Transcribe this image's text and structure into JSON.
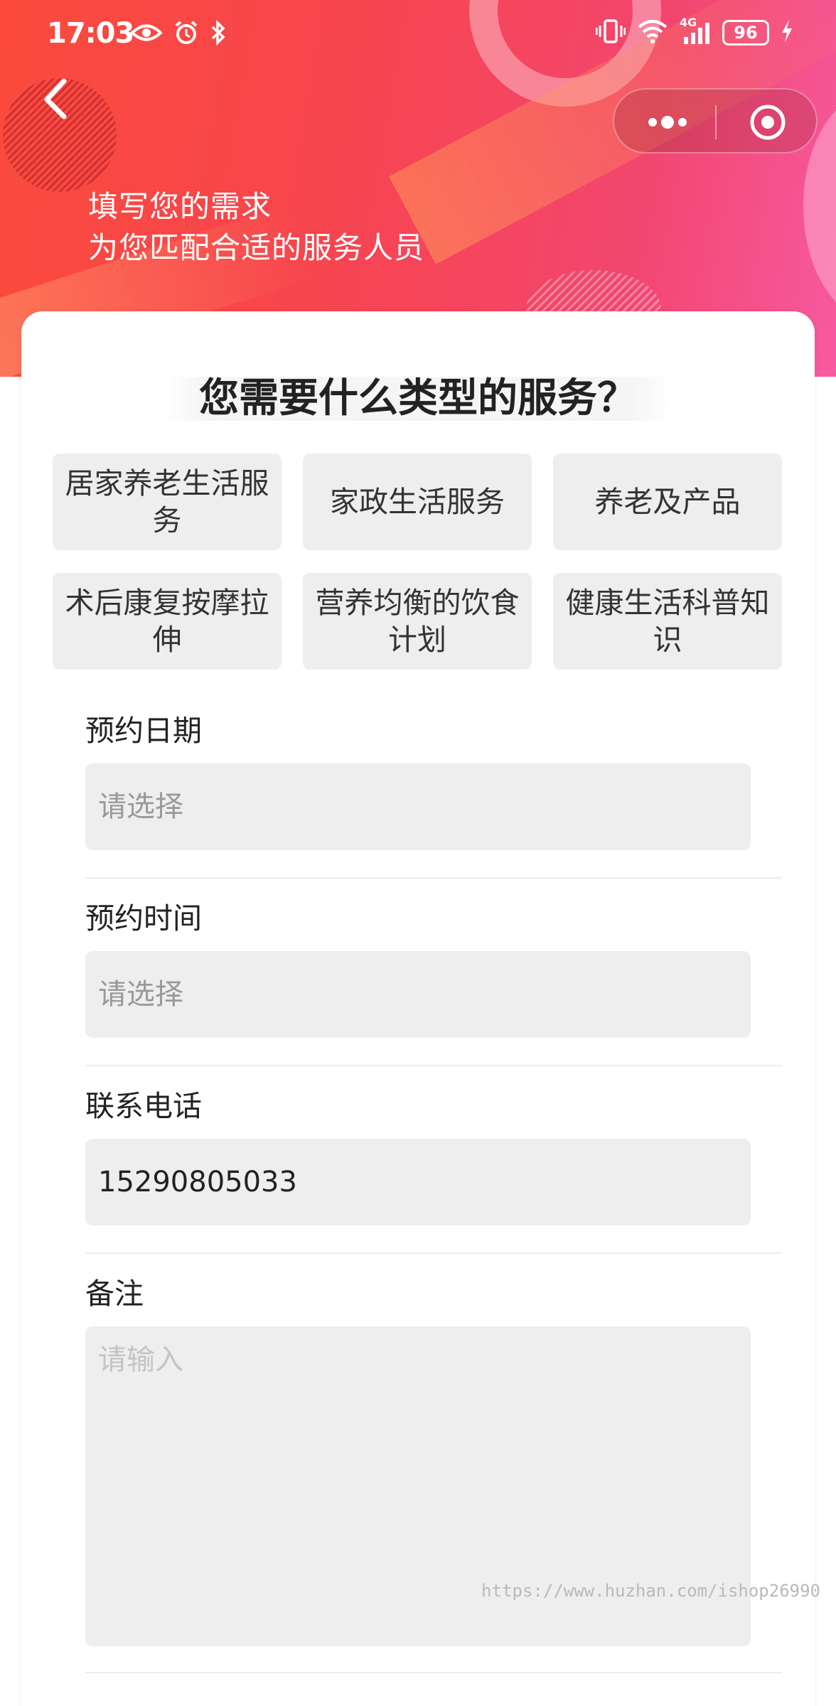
{
  "status_bar": {
    "time": "17:03",
    "battery": "96",
    "network": "4G",
    "icons": [
      "eye-icon",
      "alarm-icon",
      "bluetooth-icon",
      "vibrate-icon",
      "wifi-icon",
      "signal-icon",
      "charging-icon"
    ]
  },
  "nav": {
    "back_icon": "chevron-left-icon",
    "capsule_icons": [
      "more-dots-icon",
      "close-target-icon"
    ]
  },
  "banner": {
    "line1": "填写您的需求",
    "line2": "为您匹配合适的服务人员"
  },
  "form": {
    "title": "您需要什么类型的服务？",
    "services": [
      "居家养老生活服务",
      "家政生活服务",
      "养老及产品",
      "术后康复按摩拉伸",
      "营养均衡的饮食计划",
      "健康生活科普知识"
    ],
    "date": {
      "label": "预约日期",
      "placeholder": "请选择"
    },
    "time": {
      "label": "预约时间",
      "placeholder": "请选择"
    },
    "phone": {
      "label": "联系电话",
      "value": "15290805033"
    },
    "note": {
      "label": "备注",
      "placeholder": "请输入"
    }
  },
  "watermark": "https://www.huzhan.com/ishop26990",
  "colors": {
    "banner_start": "#fb4a3c",
    "banner_end": "#f75aa0",
    "input_bg": "#eeeeee"
  }
}
